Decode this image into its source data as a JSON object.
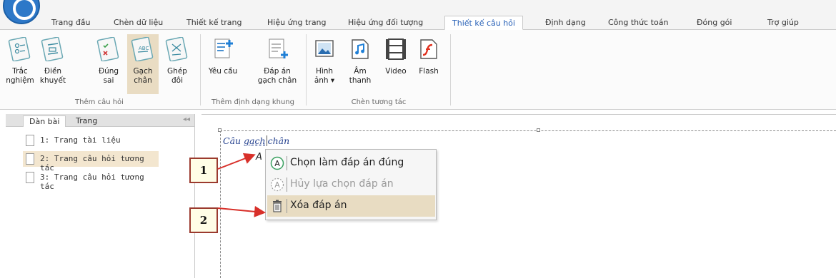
{
  "tabs": [
    {
      "label": "Trang đầu"
    },
    {
      "label": "Chèn dữ liệu"
    },
    {
      "label": "Thiết kế trang"
    },
    {
      "label": "Hiệu ứng trang"
    },
    {
      "label": "Hiệu ứng đối tượng"
    },
    {
      "label": "Thiết kế câu hỏi",
      "active": true
    },
    {
      "label": "Định dạng"
    },
    {
      "label": "Công thức toán"
    },
    {
      "label": "Đóng gói"
    },
    {
      "label": "Trợ giúp"
    }
  ],
  "ribbon": {
    "groups": [
      {
        "label": "Thêm câu hỏi"
      },
      {
        "label": "Thêm định dạng khung"
      },
      {
        "label": "Chèn tương tác"
      }
    ],
    "buttons": [
      {
        "line1": "Trắc",
        "line2": "nghiệm",
        "icon": "multiple-choice-icon"
      },
      {
        "line1": "Điền",
        "line2": "khuyết",
        "icon": "fill-blank-icon"
      },
      {
        "line1": "Đúng",
        "line2": "sai",
        "icon": "true-false-icon"
      },
      {
        "line1": "Gạch",
        "line2": "chân",
        "icon": "underline-question-icon",
        "selected": true
      },
      {
        "line1": "Ghép",
        "line2": "đôi",
        "icon": "matching-icon"
      },
      {
        "line1": "Yêu cầu",
        "line2": "",
        "icon": "request-icon"
      },
      {
        "line1": "Đáp án",
        "line2": "gạch chân",
        "icon": "underline-answer-icon"
      },
      {
        "line1": "Hình",
        "line2": "ảnh ▾",
        "icon": "image-icon"
      },
      {
        "line1": "Âm",
        "line2": "thanh",
        "icon": "audio-icon"
      },
      {
        "line1": "Video",
        "line2": "",
        "icon": "video-icon"
      },
      {
        "line1": "Flash",
        "line2": "",
        "icon": "flash-icon"
      }
    ]
  },
  "left_panel": {
    "tabs": [
      "Dàn bài",
      "Trang"
    ],
    "collapse_glyph": "◂◂",
    "slides": [
      {
        "label": "1: Trang tài liệu"
      },
      {
        "label": "2: Trang câu hỏi tương tác",
        "selected": true
      },
      {
        "label": "3: Trang câu hỏi tương tác"
      }
    ]
  },
  "canvas": {
    "question_prefix": "Câu ",
    "question_underlined": "gạch",
    "question_suffix": "chân",
    "answer_letter": "A"
  },
  "context_menu": {
    "items": [
      {
        "label": "Chọn làm đáp án đúng",
        "icon": "answer-a-icon",
        "state": "normal"
      },
      {
        "label": "Hủy lựa chọn đáp án",
        "icon": "answer-a-dashed-icon",
        "state": "disabled"
      },
      {
        "label": "Xóa đáp án",
        "icon": "trash-icon",
        "state": "hover"
      }
    ]
  },
  "callouts": [
    {
      "label": "1"
    },
    {
      "label": "2"
    }
  ],
  "colors": {
    "active_tab_text": "#2a62b8",
    "callout_border": "#9b3a2e",
    "arrow": "#d8302a",
    "hover": "#e8dcc2"
  }
}
